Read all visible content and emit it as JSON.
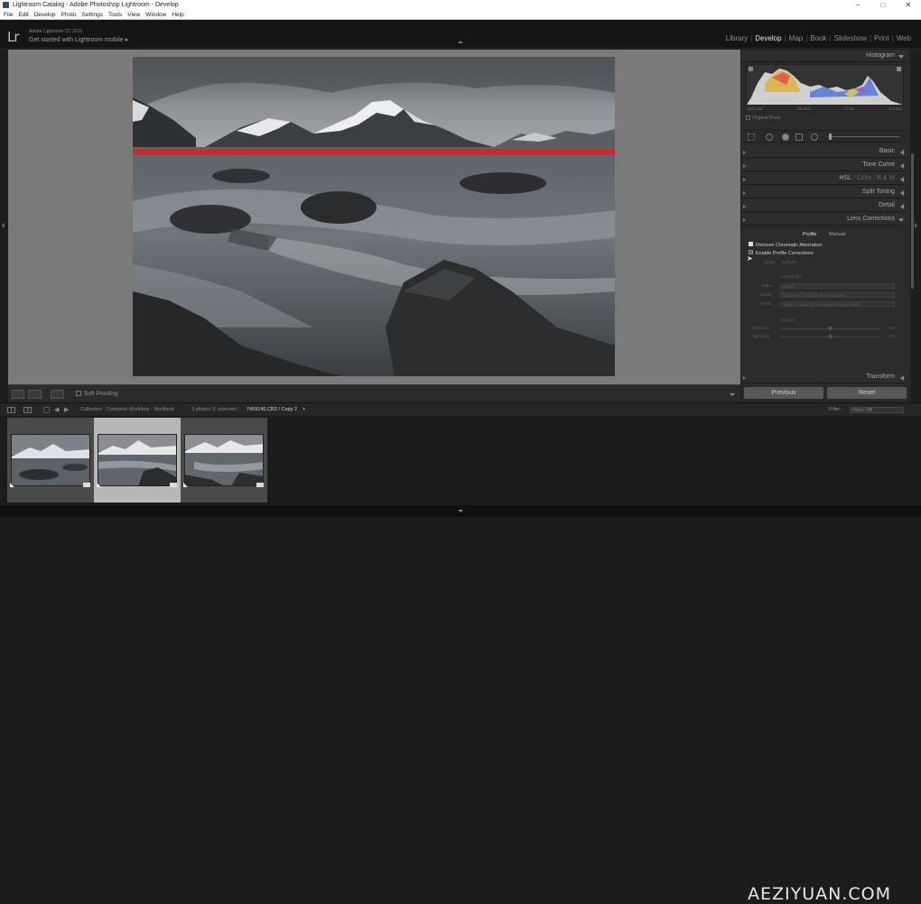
{
  "window": {
    "title": "Lightroom Catalog - Adobe Photoshop Lightroom - Develop",
    "controls": [
      "–",
      "□",
      "✕"
    ]
  },
  "menu": [
    "File",
    "Edit",
    "Develop",
    "Photo",
    "Settings",
    "Tools",
    "View",
    "Window",
    "Help"
  ],
  "identity": {
    "logo": "Lr",
    "product": "Adobe Lightroom CC 2015",
    "promo": "Get started with Lightroom mobile ▸"
  },
  "modules": [
    "Library",
    "Develop",
    "Map",
    "Book",
    "Slideshow",
    "Print",
    "Web"
  ],
  "active_module": "Develop",
  "toolbar": {
    "soft_proofing": "Soft Proofing"
  },
  "histogram": {
    "title": "Histogram",
    "meta": [
      "ISO 100",
      "20 mm",
      "f / 22",
      "0.5 sec"
    ],
    "original_photo": "Original Photo"
  },
  "panels": {
    "basic": "Basic",
    "tone_curve": "Tone Curve",
    "hsl": "HSL",
    "hsl_sep1": "/",
    "color": "Color",
    "hsl_sep2": "/",
    "bw": "B & W",
    "split_toning": "Split Toning",
    "detail": "Detail",
    "lens_corrections": "Lens Corrections",
    "transform": "Transform"
  },
  "lens": {
    "tab_profile": "Profile",
    "tab_manual": "Manual",
    "remove_ca": "Remove Chromatic Aberration",
    "enable_profile": "Enable Profile Corrections",
    "setup_label": "Setup",
    "setup_value": "Default ÷",
    "lens_profile": "Lens Profile",
    "make": "Make",
    "make_value": "Canon",
    "model": "Model",
    "model_value": "Canon EF 16-35mm f/2.8L II USM",
    "profile": "Profile",
    "profile_value": "Adobe (Canon EF 16-35mm f/2.8L II USM)",
    "amount": "Amount",
    "distortion": "Distortion",
    "distortion_value": "100",
    "vignetting": "Vignetting",
    "vignetting_value": "100"
  },
  "buttons": {
    "previous": "Previous",
    "reset": "Reset"
  },
  "filmbar": {
    "screen1": "1",
    "screen2": "2",
    "breadcrumb": "Collection : Complete Workflow - Nordland",
    "count": "3 photos /1 selected /",
    "filename": "7459140.CR2 / Copy 2",
    "filter_label": "Filter :",
    "filter_value": "Filters Off"
  },
  "filmstrip": {
    "selected_index": 1,
    "thumbs": 3
  },
  "watermark": "AEZIYUAN.COM",
  "colors": {
    "accent_red": "#e01e1e",
    "panel_bg": "#2a2a2a",
    "workspace_bg": "#7a7a7a"
  }
}
